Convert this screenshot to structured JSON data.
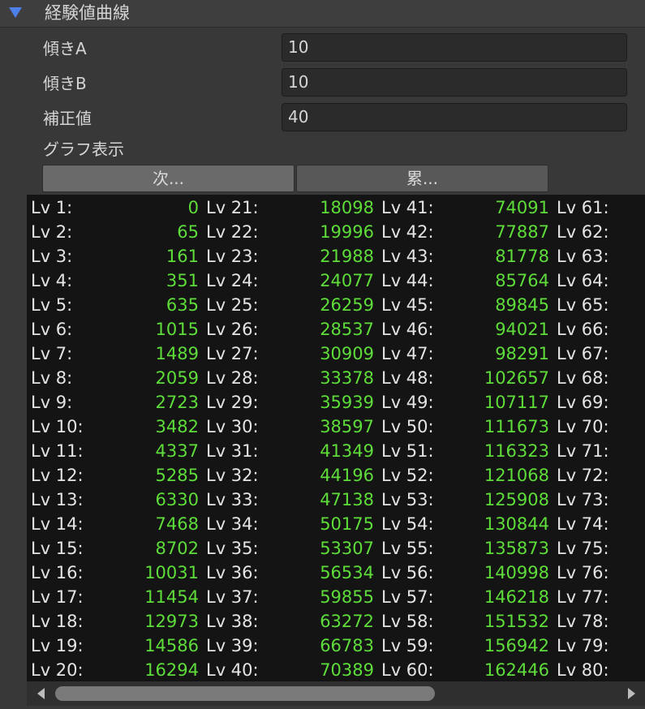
{
  "section": {
    "title": "経験値曲線",
    "toggle_icon": "triangle-down-icon",
    "toggle_color": "#4f7fe8"
  },
  "fields": [
    {
      "label": "傾きA",
      "value": "10"
    },
    {
      "label": "傾きB",
      "value": "10"
    },
    {
      "label": "補正値",
      "value": "40"
    }
  ],
  "graph": {
    "label": "グラフ表示",
    "buttons": [
      "次...",
      "累..."
    ]
  },
  "table": {
    "value_color": "#5edd3a",
    "columns": [
      {
        "levels": [
          "Lv 1:",
          "Lv 2:",
          "Lv 3:",
          "Lv 4:",
          "Lv 5:",
          "Lv 6:",
          "Lv 7:",
          "Lv 8:",
          "Lv 9:",
          "Lv 10:",
          "Lv 11:",
          "Lv 12:",
          "Lv 13:",
          "Lv 14:",
          "Lv 15:",
          "Lv 16:",
          "Lv 17:",
          "Lv 18:",
          "Lv 19:",
          "Lv 20:"
        ],
        "values": [
          "0",
          "65",
          "161",
          "351",
          "635",
          "1015",
          "1489",
          "2059",
          "2723",
          "3482",
          "4337",
          "5285",
          "6330",
          "7468",
          "8702",
          "10031",
          "11454",
          "12973",
          "14586",
          "16294"
        ]
      },
      {
        "levels": [
          "Lv 21:",
          "Lv 22:",
          "Lv 23:",
          "Lv 24:",
          "Lv 25:",
          "Lv 26:",
          "Lv 27:",
          "Lv 28:",
          "Lv 29:",
          "Lv 30:",
          "Lv 31:",
          "Lv 32:",
          "Lv 33:",
          "Lv 34:",
          "Lv 35:",
          "Lv 36:",
          "Lv 37:",
          "Lv 38:",
          "Lv 39:",
          "Lv 40:"
        ],
        "values": [
          "18098",
          "19996",
          "21988",
          "24077",
          "26259",
          "28537",
          "30909",
          "33378",
          "35939",
          "38597",
          "41349",
          "44196",
          "47138",
          "50175",
          "53307",
          "56534",
          "59855",
          "63272",
          "66783",
          "70389"
        ]
      },
      {
        "levels": [
          "Lv 41:",
          "Lv 42:",
          "Lv 43:",
          "Lv 44:",
          "Lv 45:",
          "Lv 46:",
          "Lv 47:",
          "Lv 48:",
          "Lv 49:",
          "Lv 50:",
          "Lv 51:",
          "Lv 52:",
          "Lv 53:",
          "Lv 54:",
          "Lv 55:",
          "Lv 56:",
          "Lv 57:",
          "Lv 58:",
          "Lv 59:",
          "Lv 60:"
        ],
        "values": [
          "74091",
          "77887",
          "81778",
          "85764",
          "89845",
          "94021",
          "98291",
          "102657",
          "107117",
          "111673",
          "116323",
          "121068",
          "125908",
          "130844",
          "135873",
          "140998",
          "146218",
          "151532",
          "156942",
          "162446"
        ]
      },
      {
        "levels": [
          "Lv 61:",
          "Lv 62:",
          "Lv 63:",
          "Lv 64:",
          "Lv 65:",
          "Lv 66:",
          "Lv 67:",
          "Lv 68:",
          "Lv 69:",
          "Lv 70:",
          "Lv 71:",
          "Lv 72:",
          "Lv 73:",
          "Lv 74:",
          "Lv 75:",
          "Lv 76:",
          "Lv 77:",
          "Lv 78:",
          "Lv 79:",
          "Lv 80:"
        ],
        "values": []
      }
    ]
  },
  "scrollbar": {
    "left_icon": "arrow-left-icon",
    "right_icon": "arrow-right-icon"
  }
}
